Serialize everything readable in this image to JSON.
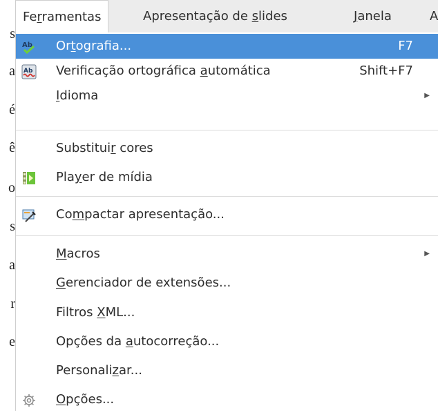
{
  "background_doc": {
    "letters": [
      "s",
      "a",
      "é",
      "ê",
      "o",
      "s",
      "a",
      "r",
      "e"
    ]
  },
  "menubar": {
    "items": [
      {
        "pre": "Fe",
        "u": "r",
        "post": "ramentas",
        "active": true
      },
      {
        "pre": "Apresentação de ",
        "u": "s",
        "post": "lides",
        "active": false
      },
      {
        "pre": "",
        "u": "J",
        "post": "anela",
        "active": false
      },
      {
        "pre": "A",
        "u": "",
        "post": "",
        "active": false
      }
    ]
  },
  "menu": {
    "items": [
      {
        "pre": "Or",
        "u": "t",
        "post": "ografia...",
        "shortcut": "F7",
        "icon": "spellcheck-icon",
        "highlight": true
      },
      {
        "pre": "Verificação ortográfica ",
        "u": "a",
        "post": "utomática",
        "shortcut": "Shift+F7",
        "icon": "auto-spellcheck-icon"
      },
      {
        "pre": "",
        "u": "I",
        "post": "dioma",
        "submenu": true
      },
      {
        "pre": "Substitui",
        "u": "r",
        "post": " cores"
      },
      {
        "pre": "Pla",
        "u": "y",
        "post": "er de mídia",
        "icon": "media-player-icon"
      },
      {
        "pre": "Co",
        "u": "m",
        "post": "pactar apresentação...",
        "icon": "compress-presentation-icon"
      },
      {
        "pre": "",
        "u": "M",
        "post": "acros",
        "submenu": true
      },
      {
        "pre": "",
        "u": "G",
        "post": "erenciador de extensões..."
      },
      {
        "pre": "Filtros ",
        "u": "X",
        "post": "ML..."
      },
      {
        "pre": "Opções da ",
        "u": "a",
        "post": "utocorreção..."
      },
      {
        "pre": "Personali",
        "u": "z",
        "post": "ar..."
      },
      {
        "pre": "",
        "u": "O",
        "post": "pções...",
        "icon": "gear-icon"
      }
    ]
  }
}
